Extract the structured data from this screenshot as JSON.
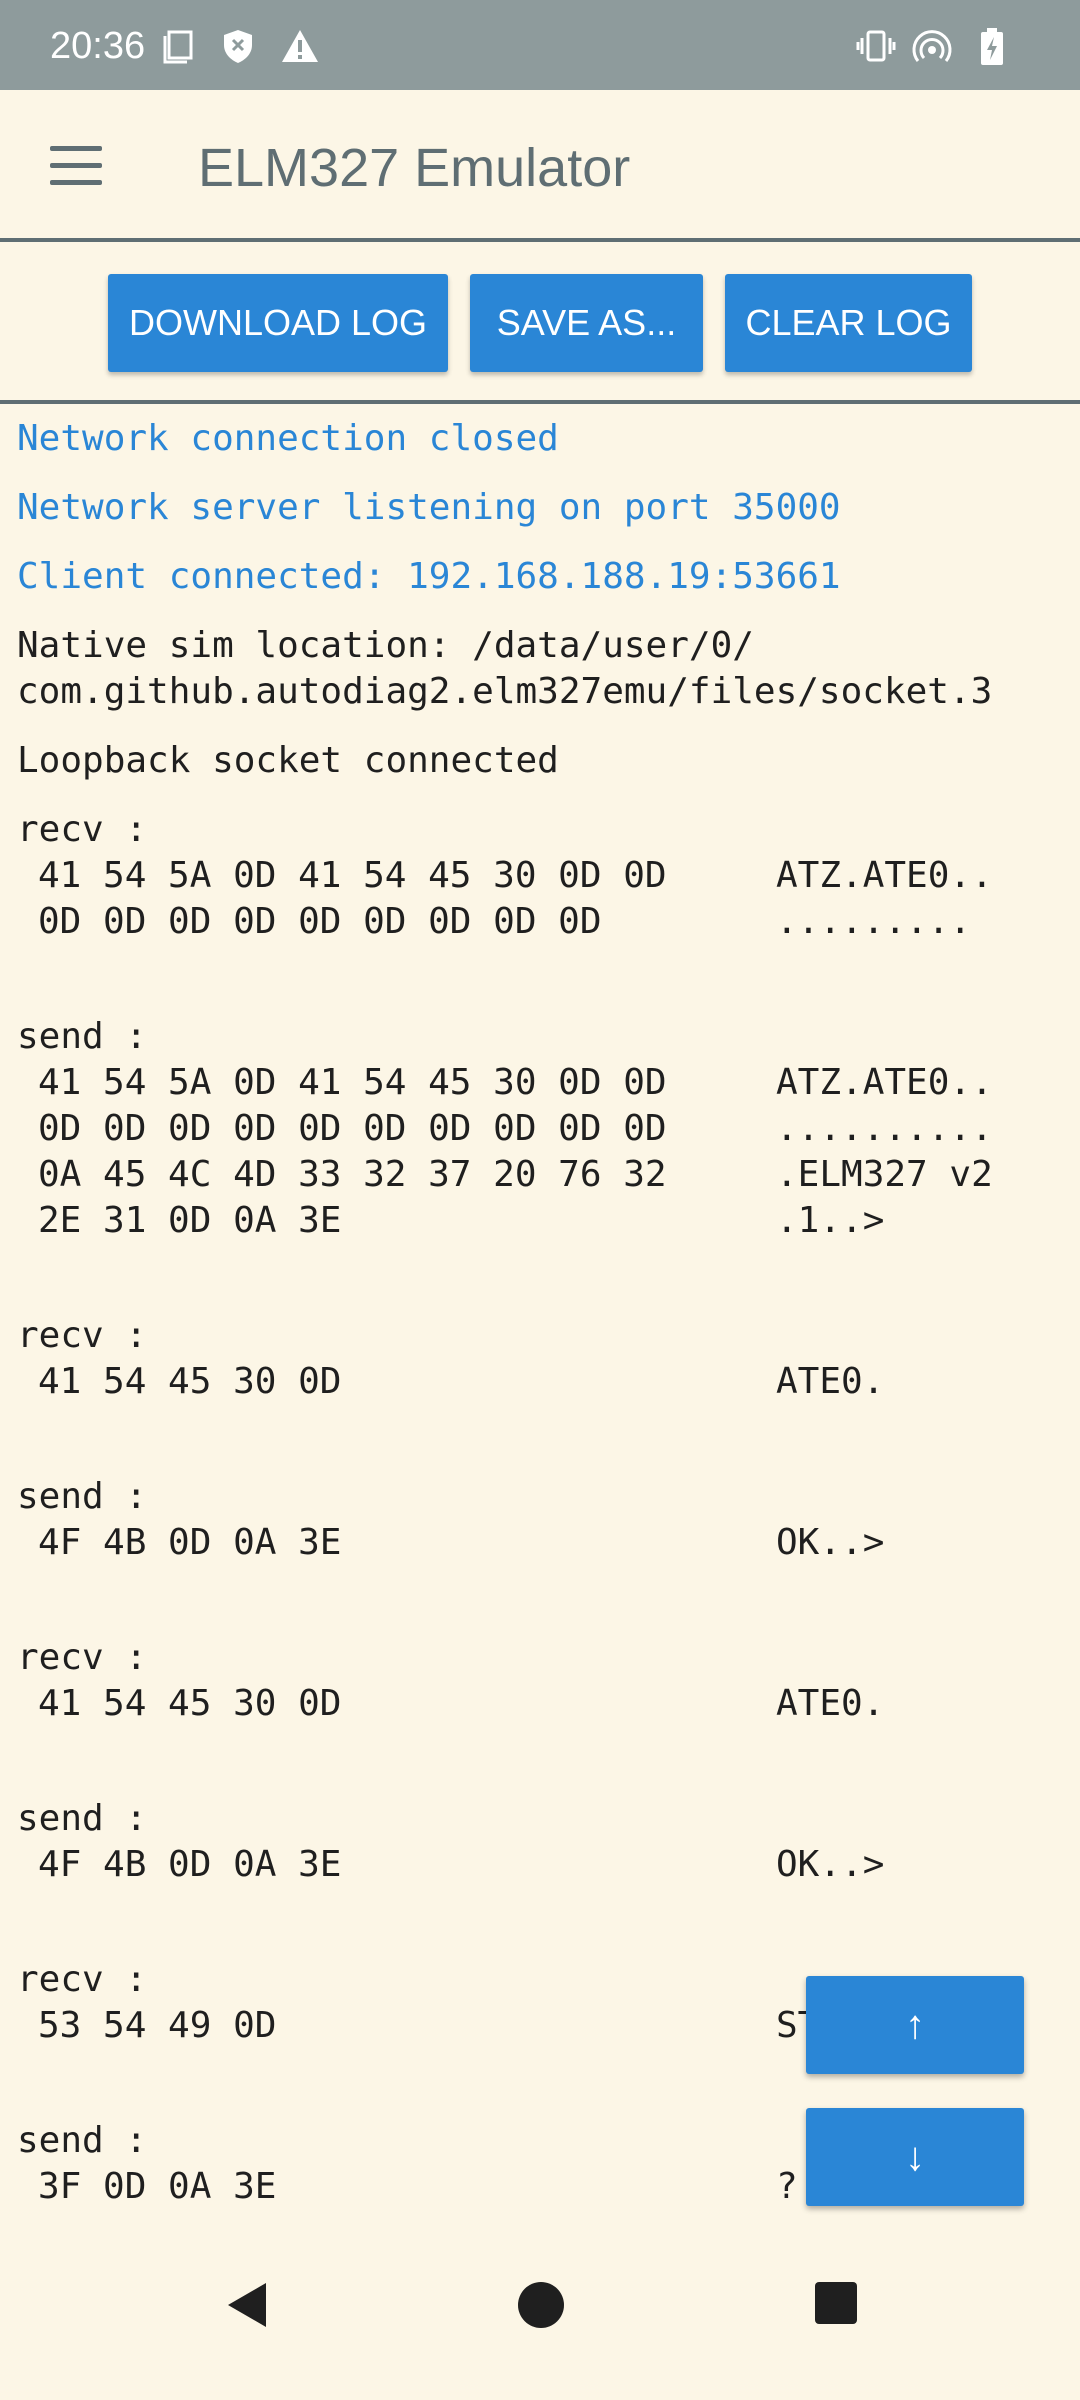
{
  "status_bar": {
    "time": "20:36",
    "left_icons": [
      "screenshot-icon",
      "shield-x-icon",
      "warning-icon"
    ],
    "right_icons": [
      "vibrate-icon",
      "hotspot-icon",
      "battery-charging-icon"
    ]
  },
  "app_bar": {
    "title": "ELM327 Emulator",
    "menu_icon": "hamburger-menu-icon"
  },
  "toolbar": {
    "download_label": "DOWNLOAD LOG",
    "save_label": "SAVE AS...",
    "clear_label": "CLEAR LOG"
  },
  "log": {
    "messages": [
      "Network connection closed",
      "Network server listening on port 35000",
      "Client connected: 192.168.188.19:53661",
      "Native sim location: /data/user/0/",
      "com.github.autodiag2.elm327emu/files/socket.3",
      "Loopback socket connected"
    ],
    "entries": [
      {
        "label": "recv :",
        "rows": [
          {
            "hex": "41 54 5A 0D 41 54 45 30 0D 0D",
            "ascii": "ATZ.ATE0.."
          },
          {
            "hex": "0D 0D 0D 0D 0D 0D 0D 0D 0D",
            "ascii": "........."
          }
        ]
      },
      {
        "label": "send :",
        "rows": [
          {
            "hex": "41 54 5A 0D 41 54 45 30 0D 0D",
            "ascii": "ATZ.ATE0.."
          },
          {
            "hex": "0D 0D 0D 0D 0D 0D 0D 0D 0D 0D",
            "ascii": ".........."
          },
          {
            "hex": "0A 45 4C 4D 33 32 37 20 76 32",
            "ascii": ".ELM327 v2"
          },
          {
            "hex": "2E 31 0D 0A 3E",
            "ascii": ".1..>"
          }
        ]
      },
      {
        "label": "recv :",
        "rows": [
          {
            "hex": "41 54 45 30 0D",
            "ascii": "ATE0."
          }
        ]
      },
      {
        "label": "send :",
        "rows": [
          {
            "hex": "4F 4B 0D 0A 3E",
            "ascii": "OK..>"
          }
        ]
      },
      {
        "label": "recv :",
        "rows": [
          {
            "hex": "41 54 45 30 0D",
            "ascii": "ATE0."
          }
        ]
      },
      {
        "label": "send :",
        "rows": [
          {
            "hex": "4F 4B 0D 0A 3E",
            "ascii": "OK..>"
          }
        ]
      },
      {
        "label": "recv :",
        "rows": [
          {
            "hex": "53 54 49 0D",
            "ascii": "ST"
          }
        ]
      },
      {
        "label": "send :",
        "rows": [
          {
            "hex": "3F 0D 0A 3E",
            "ascii": "?"
          }
        ]
      }
    ]
  },
  "fab": {
    "up_label": "↑",
    "down_label": "↓"
  },
  "nav_bar": {
    "icons": [
      "back-icon",
      "home-icon",
      "recents-icon"
    ]
  },
  "colors": {
    "background": "#fcf6e6",
    "status_bar": "#8e9b9c",
    "accent": "#2a86d6",
    "title": "#5f6e73",
    "text": "#1f1f1f"
  }
}
